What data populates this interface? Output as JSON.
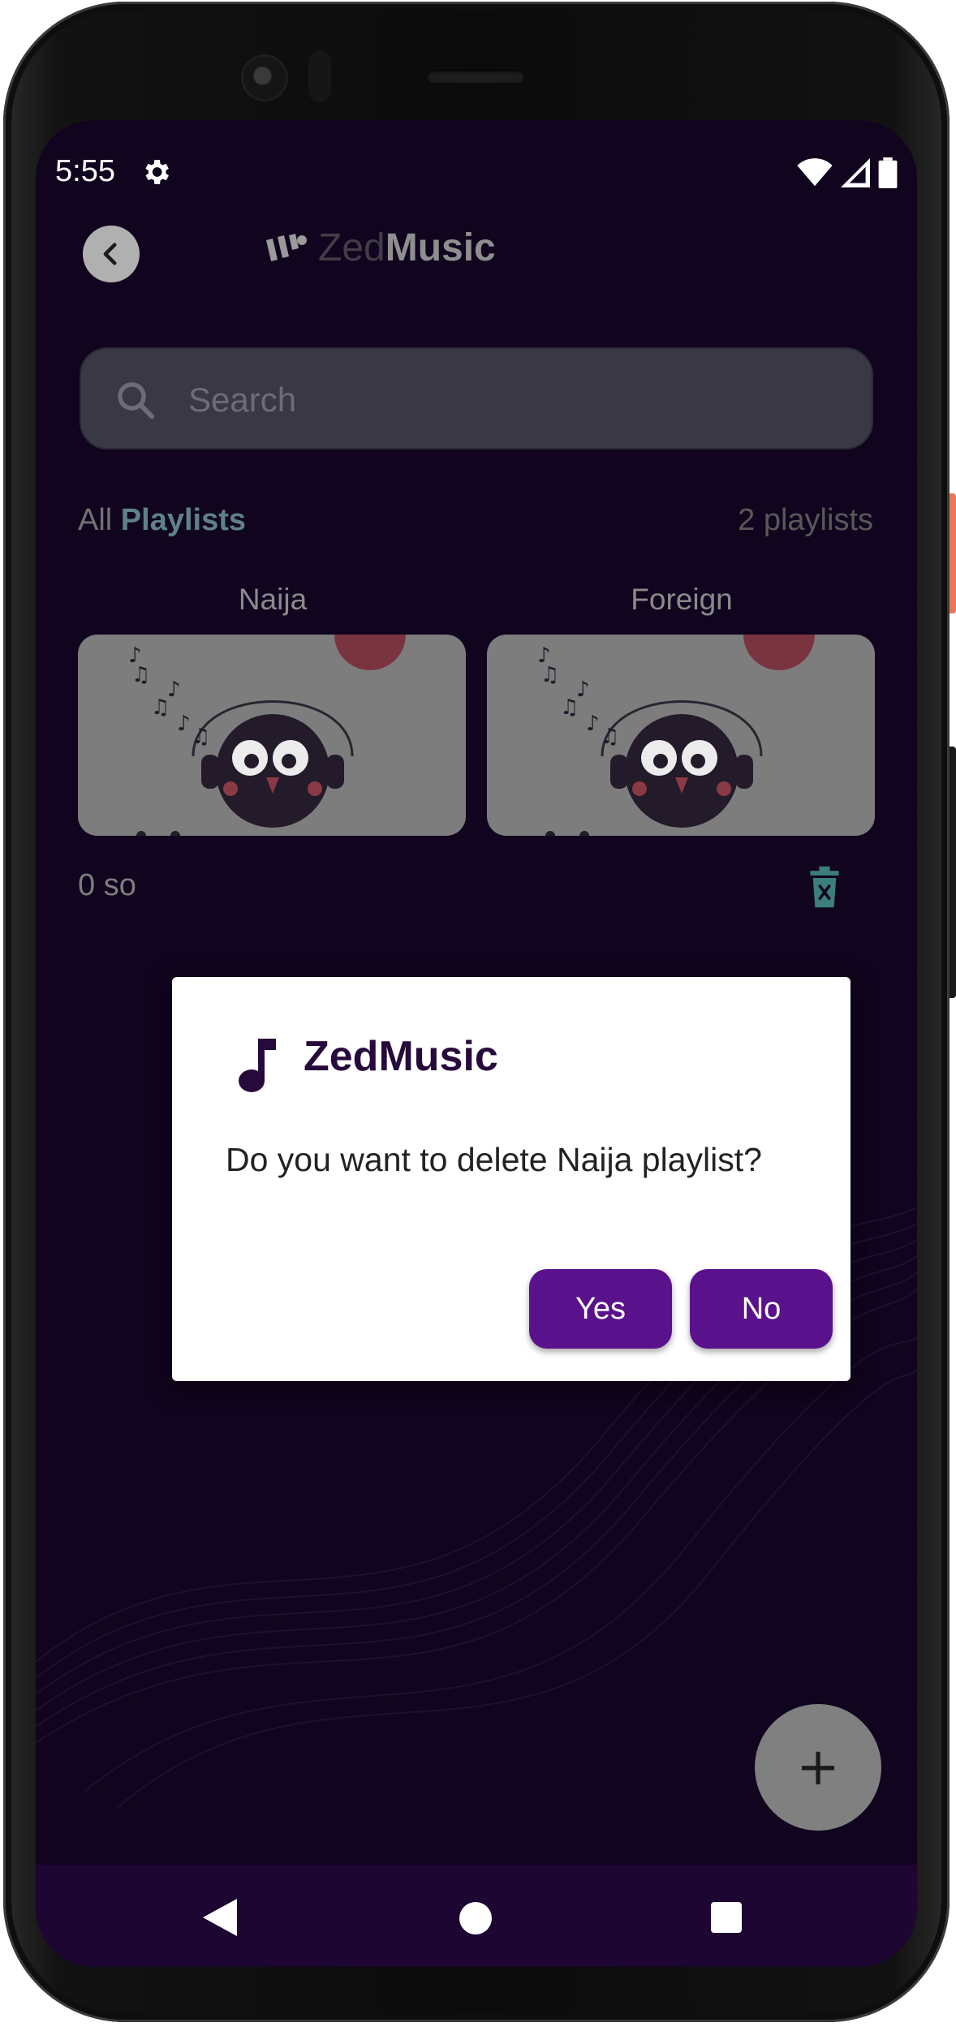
{
  "status_bar": {
    "time": "5:55"
  },
  "header": {
    "logo_light": "Zed",
    "logo_bold": "Music"
  },
  "search": {
    "placeholder": "Search"
  },
  "playlists": {
    "label_all": "All",
    "label_playlists": "Playlists",
    "count_text": "2 playlists",
    "items": [
      {
        "title": "Naija"
      },
      {
        "title": "Foreign"
      }
    ],
    "songs_count_text": "0 so"
  },
  "dialog": {
    "title": "ZedMusic",
    "message": "Do you want to delete Naija playlist?",
    "yes_label": "Yes",
    "no_label": "No"
  },
  "fab": {
    "symbol": "+"
  },
  "colors": {
    "background": "#10041e",
    "accent": "#5a128c",
    "nav_bar": "#1e0632",
    "dialog_title": "#260a3b"
  },
  "icons": {
    "settings": "gear-icon",
    "wifi": "wifi-icon",
    "signal": "signal-icon",
    "battery": "battery-icon",
    "back": "chevron-left-icon",
    "search": "search-icon",
    "delete": "trash-icon",
    "music_note": "music-note-icon"
  }
}
